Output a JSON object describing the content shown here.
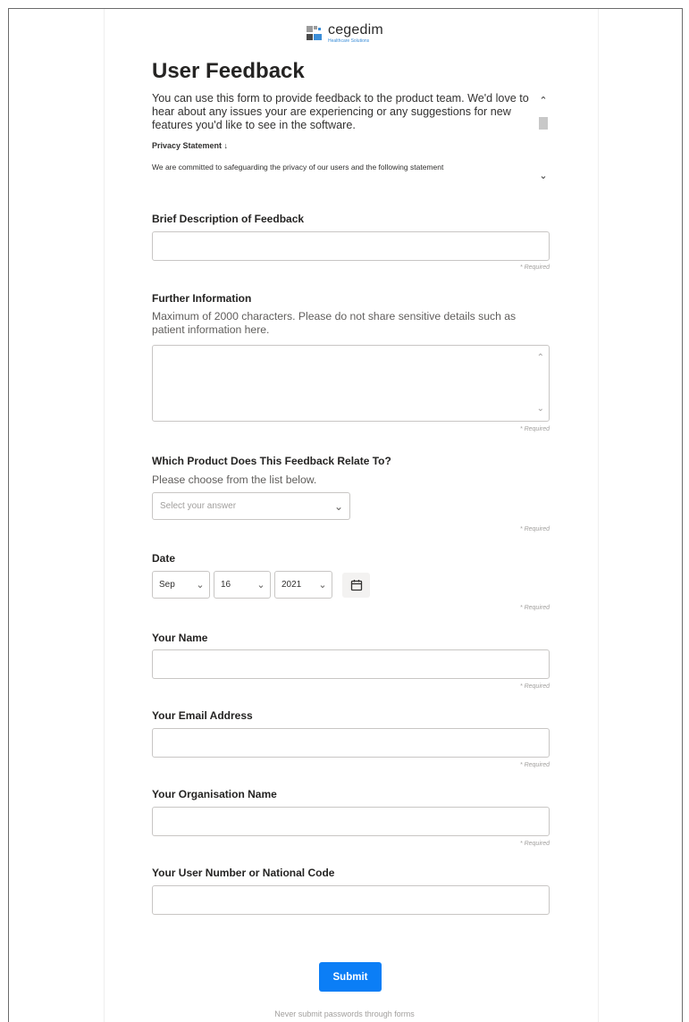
{
  "brand": {
    "name": "cegedim",
    "tagline": "Healthcare Solutions",
    "colors": {
      "blue": "#3b8ed8",
      "grey": "#9b9b9b",
      "dark": "#4a4a4a"
    }
  },
  "form": {
    "title": "User Feedback",
    "intro": "You can use this form to provide feedback to the product team. We'd love to hear about any issues your are experiencing or any suggestions for new features you'd like to see in the software.",
    "privacy_heading": "Privacy Statement ↓",
    "privacy_body": "We are committed to safeguarding the privacy of our users and the following statement",
    "required_text": "* Required",
    "accent": "#0b7ef6"
  },
  "questions": {
    "brief": {
      "label": "Brief Description of Feedback",
      "value": ""
    },
    "further": {
      "label": "Further Information",
      "help": "Maximum of 2000 characters. Please do not share sensitive details such as patient information here.",
      "value": ""
    },
    "product": {
      "label": "Which Product Does This Feedback Relate To?",
      "help": "Please choose from the list below.",
      "placeholder": "Select your answer"
    },
    "date": {
      "label": "Date",
      "month": "Sep",
      "day": "16",
      "year": "2021",
      "icon": "calendar-icon"
    },
    "name": {
      "label": "Your Name",
      "value": ""
    },
    "email": {
      "label": "Your Email Address",
      "value": ""
    },
    "org": {
      "label": "Your Organisation Name",
      "value": ""
    },
    "user_number": {
      "label": "Your User Number or National Code",
      "value": ""
    }
  },
  "actions": {
    "submit_label": "Submit",
    "footer_note": "Never submit passwords through forms"
  }
}
